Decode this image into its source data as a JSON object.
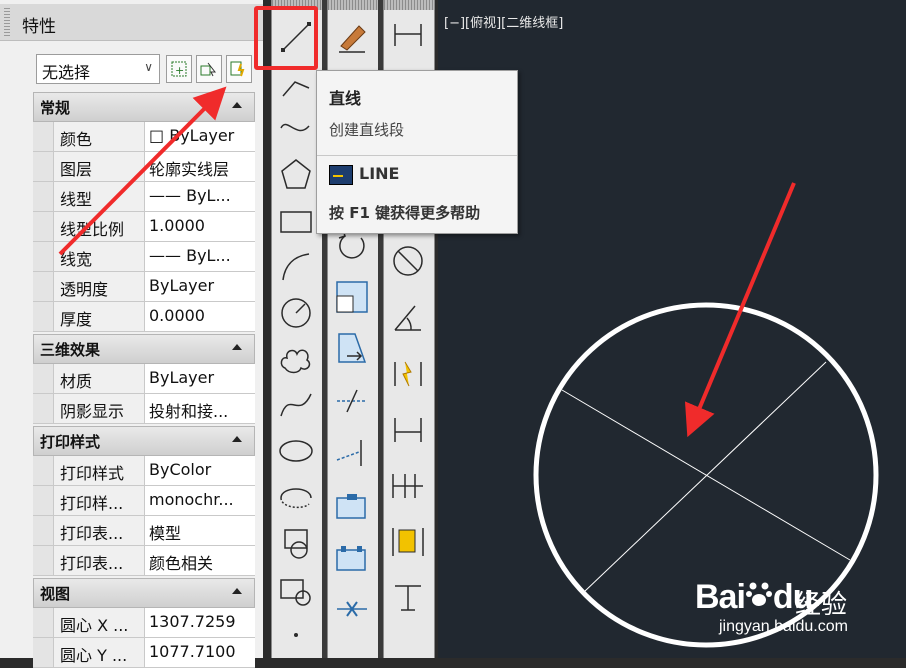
{
  "properties": {
    "title": "特性",
    "selection": "无选择",
    "sections": [
      {
        "title": "常规",
        "rows": [
          {
            "key": "颜色",
            "value": "□ ByLayer"
          },
          {
            "key": "图层",
            "value": "轮廓实线层"
          },
          {
            "key": "线型",
            "value": "—— ByL..."
          },
          {
            "key": "线型比例",
            "value": "1.0000"
          },
          {
            "key": "线宽",
            "value": "—— ByL..."
          },
          {
            "key": "透明度",
            "value": "ByLayer"
          },
          {
            "key": "厚度",
            "value": "0.0000"
          }
        ]
      },
      {
        "title": "三维效果",
        "rows": [
          {
            "key": "材质",
            "value": "ByLayer"
          },
          {
            "key": "阴影显示",
            "value": "投射和接..."
          }
        ]
      },
      {
        "title": "打印样式",
        "rows": [
          {
            "key": "打印样式",
            "value": "ByColor"
          },
          {
            "key": "打印样...",
            "value": "monochr..."
          },
          {
            "key": "打印表...",
            "value": "模型"
          },
          {
            "key": "打印表...",
            "value": "颜色相关"
          }
        ]
      },
      {
        "title": "视图",
        "rows": [
          {
            "key": "圆心 X ...",
            "value": "1307.7259"
          },
          {
            "key": "圆心 Y ...",
            "value": "1077.7100"
          }
        ]
      }
    ]
  },
  "tooltip": {
    "title": "直线",
    "description": "创建直线段",
    "command": "LINE",
    "help": "按 F1 键获得更多帮助"
  },
  "viewport": {
    "label": "[−][俯视][二维线框]"
  },
  "watermark": {
    "brand": "Bai",
    "brand2": "du",
    "cn": "经验",
    "url": "jingyan.baidu.com"
  },
  "colors": {
    "highlight": "#f02b2b",
    "arrow": "#f02b2b",
    "viewport_bg": "#212830",
    "geometry": "#ffffff"
  },
  "icons": {
    "draw_palette": [
      "line-icon",
      "polyline-icon",
      "spline-icon",
      "polygon-icon",
      "rectangle-icon",
      "arc-icon",
      "circle-icon",
      "revision-cloud-icon",
      "spline-curve-icon",
      "ellipse-icon",
      "ellipse-arc-icon",
      "insert-block-icon",
      "make-block-icon",
      "point-icon"
    ],
    "modify_palette": [
      "erase-icon",
      "copy-icon",
      "mirror-icon",
      "move-icon",
      "rotate-icon",
      "scale-icon",
      "stretch-icon",
      "trim-icon",
      "extend-icon",
      "break-icon",
      "join-icon",
      "fillet-icon"
    ],
    "dimension_palette": [
      "linear-dim-icon",
      "aligned-dim-icon",
      "arc-length-icon",
      "radius-dim-icon",
      "diameter-dim-icon",
      "angular-dim-icon",
      "jogged-linear-icon",
      "baseline-dim-icon",
      "continue-dim-icon",
      "tolerance-icon",
      "center-mark-icon"
    ]
  }
}
